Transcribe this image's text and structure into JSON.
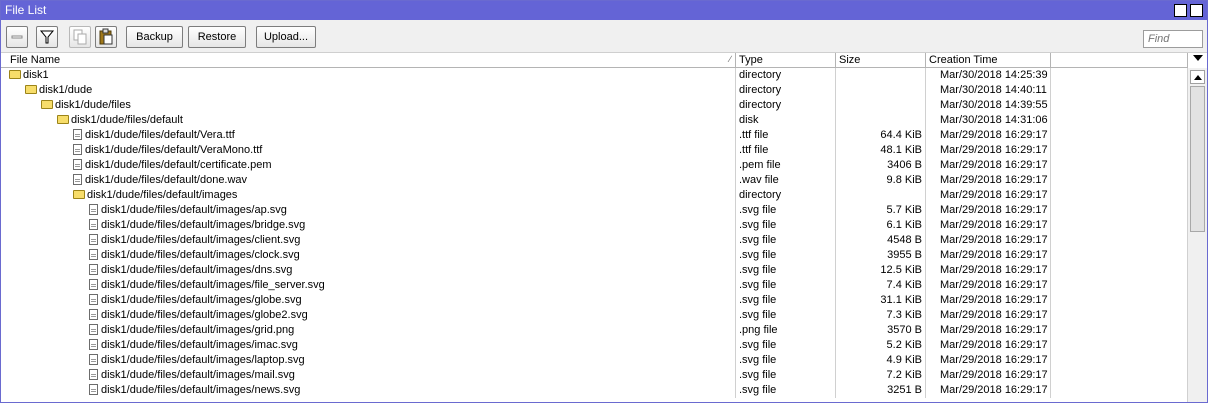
{
  "window": {
    "title": "File List"
  },
  "toolbar": {
    "backup_label": "Backup",
    "restore_label": "Restore",
    "upload_label": "Upload...",
    "find_placeholder": "Find"
  },
  "columns": {
    "name": "File Name",
    "type": "Type",
    "size": "Size",
    "time": "Creation Time"
  },
  "rows": [
    {
      "name": "disk1",
      "type": "directory",
      "size": "",
      "time": "Mar/30/2018 14:25:39",
      "icon": "folder-icon",
      "indent": 0
    },
    {
      "name": "disk1/dude",
      "type": "directory",
      "size": "",
      "time": "Mar/30/2018 14:40:11",
      "icon": "folder-icon",
      "indent": 1
    },
    {
      "name": "disk1/dude/files",
      "type": "directory",
      "size": "",
      "time": "Mar/30/2018 14:39:55",
      "icon": "folder-icon",
      "indent": 2
    },
    {
      "name": "disk1/dude/files/default",
      "type": "disk",
      "size": "",
      "time": "Mar/30/2018 14:31:06",
      "icon": "folder-icon",
      "indent": 3
    },
    {
      "name": "disk1/dude/files/default/Vera.ttf",
      "type": ".ttf file",
      "size": "64.4 KiB",
      "time": "Mar/29/2018 16:29:17",
      "icon": "file-icon",
      "indent": 4
    },
    {
      "name": "disk1/dude/files/default/VeraMono.ttf",
      "type": ".ttf file",
      "size": "48.1 KiB",
      "time": "Mar/29/2018 16:29:17",
      "icon": "file-icon",
      "indent": 4
    },
    {
      "name": "disk1/dude/files/default/certificate.pem",
      "type": ".pem file",
      "size": "3406 B",
      "time": "Mar/29/2018 16:29:17",
      "icon": "file-icon",
      "indent": 4
    },
    {
      "name": "disk1/dude/files/default/done.wav",
      "type": ".wav file",
      "size": "9.8 KiB",
      "time": "Mar/29/2018 16:29:17",
      "icon": "file-icon",
      "indent": 4
    },
    {
      "name": "disk1/dude/files/default/images",
      "type": "directory",
      "size": "",
      "time": "Mar/29/2018 16:29:17",
      "icon": "folder-icon",
      "indent": 4
    },
    {
      "name": "disk1/dude/files/default/images/ap.svg",
      "type": ".svg file",
      "size": "5.7 KiB",
      "time": "Mar/29/2018 16:29:17",
      "icon": "file-icon",
      "indent": 5
    },
    {
      "name": "disk1/dude/files/default/images/bridge.svg",
      "type": ".svg file",
      "size": "6.1 KiB",
      "time": "Mar/29/2018 16:29:17",
      "icon": "file-icon",
      "indent": 5
    },
    {
      "name": "disk1/dude/files/default/images/client.svg",
      "type": ".svg file",
      "size": "4548 B",
      "time": "Mar/29/2018 16:29:17",
      "icon": "file-icon",
      "indent": 5
    },
    {
      "name": "disk1/dude/files/default/images/clock.svg",
      "type": ".svg file",
      "size": "3955 B",
      "time": "Mar/29/2018 16:29:17",
      "icon": "file-icon",
      "indent": 5
    },
    {
      "name": "disk1/dude/files/default/images/dns.svg",
      "type": ".svg file",
      "size": "12.5 KiB",
      "time": "Mar/29/2018 16:29:17",
      "icon": "file-icon",
      "indent": 5
    },
    {
      "name": "disk1/dude/files/default/images/file_server.svg",
      "type": ".svg file",
      "size": "7.4 KiB",
      "time": "Mar/29/2018 16:29:17",
      "icon": "file-icon",
      "indent": 5
    },
    {
      "name": "disk1/dude/files/default/images/globe.svg",
      "type": ".svg file",
      "size": "31.1 KiB",
      "time": "Mar/29/2018 16:29:17",
      "icon": "file-icon",
      "indent": 5
    },
    {
      "name": "disk1/dude/files/default/images/globe2.svg",
      "type": ".svg file",
      "size": "7.3 KiB",
      "time": "Mar/29/2018 16:29:17",
      "icon": "file-icon",
      "indent": 5
    },
    {
      "name": "disk1/dude/files/default/images/grid.png",
      "type": ".png file",
      "size": "3570 B",
      "time": "Mar/29/2018 16:29:17",
      "icon": "file-icon",
      "indent": 5
    },
    {
      "name": "disk1/dude/files/default/images/imac.svg",
      "type": ".svg file",
      "size": "5.2 KiB",
      "time": "Mar/29/2018 16:29:17",
      "icon": "file-icon",
      "indent": 5
    },
    {
      "name": "disk1/dude/files/default/images/laptop.svg",
      "type": ".svg file",
      "size": "4.9 KiB",
      "time": "Mar/29/2018 16:29:17",
      "icon": "file-icon",
      "indent": 5
    },
    {
      "name": "disk1/dude/files/default/images/mail.svg",
      "type": ".svg file",
      "size": "7.2 KiB",
      "time": "Mar/29/2018 16:29:17",
      "icon": "file-icon",
      "indent": 5
    },
    {
      "name": "disk1/dude/files/default/images/news.svg",
      "type": ".svg file",
      "size": "3251 B",
      "time": "Mar/29/2018 16:29:17",
      "icon": "file-icon",
      "indent": 5
    }
  ],
  "colors": {
    "titlebar": "#6464d6",
    "folder": "#f7dd6a"
  }
}
